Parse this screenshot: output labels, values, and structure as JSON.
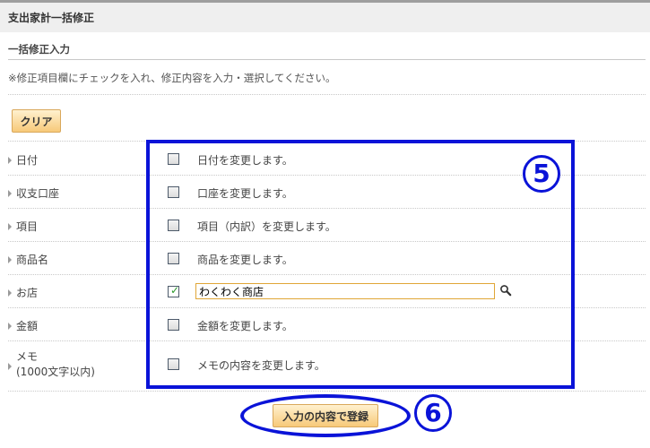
{
  "header": {
    "title": "支出家計一括修正"
  },
  "section": {
    "title": "一括修正入力",
    "instruction": "※修正項目欄にチェックを入れ、修正内容を入力・選択してください。"
  },
  "toolbar": {
    "clear_label": "クリア"
  },
  "rows": [
    {
      "label": "日付",
      "text": "日付を変更します。",
      "checked": false
    },
    {
      "label": "収支口座",
      "text": "口座を変更します。",
      "checked": false
    },
    {
      "label": "項目",
      "text": "項目（内訳）を変更します。",
      "checked": false
    },
    {
      "label": "商品名",
      "text": "商品を変更します。",
      "checked": false
    },
    {
      "label": "お店",
      "value": "わくわく商店",
      "checked": true
    },
    {
      "label": "金額",
      "text": "金額を変更します。",
      "checked": false
    },
    {
      "label": "メモ",
      "label_sub": "(1000文字以内)",
      "text": "メモの内容を変更します。",
      "checked": false
    }
  ],
  "annotations": {
    "callout_5": "5",
    "callout_6": "6"
  },
  "submit": {
    "label": "入力の内容で登録"
  },
  "colors": {
    "annotation_blue": "#0a13d8",
    "button_orange": "#f7c979",
    "input_border": "#e0a637",
    "check_green": "#2a9a2a"
  },
  "icons": {
    "search": "magnifier-icon",
    "row_marker": "triangle-right-icon"
  }
}
